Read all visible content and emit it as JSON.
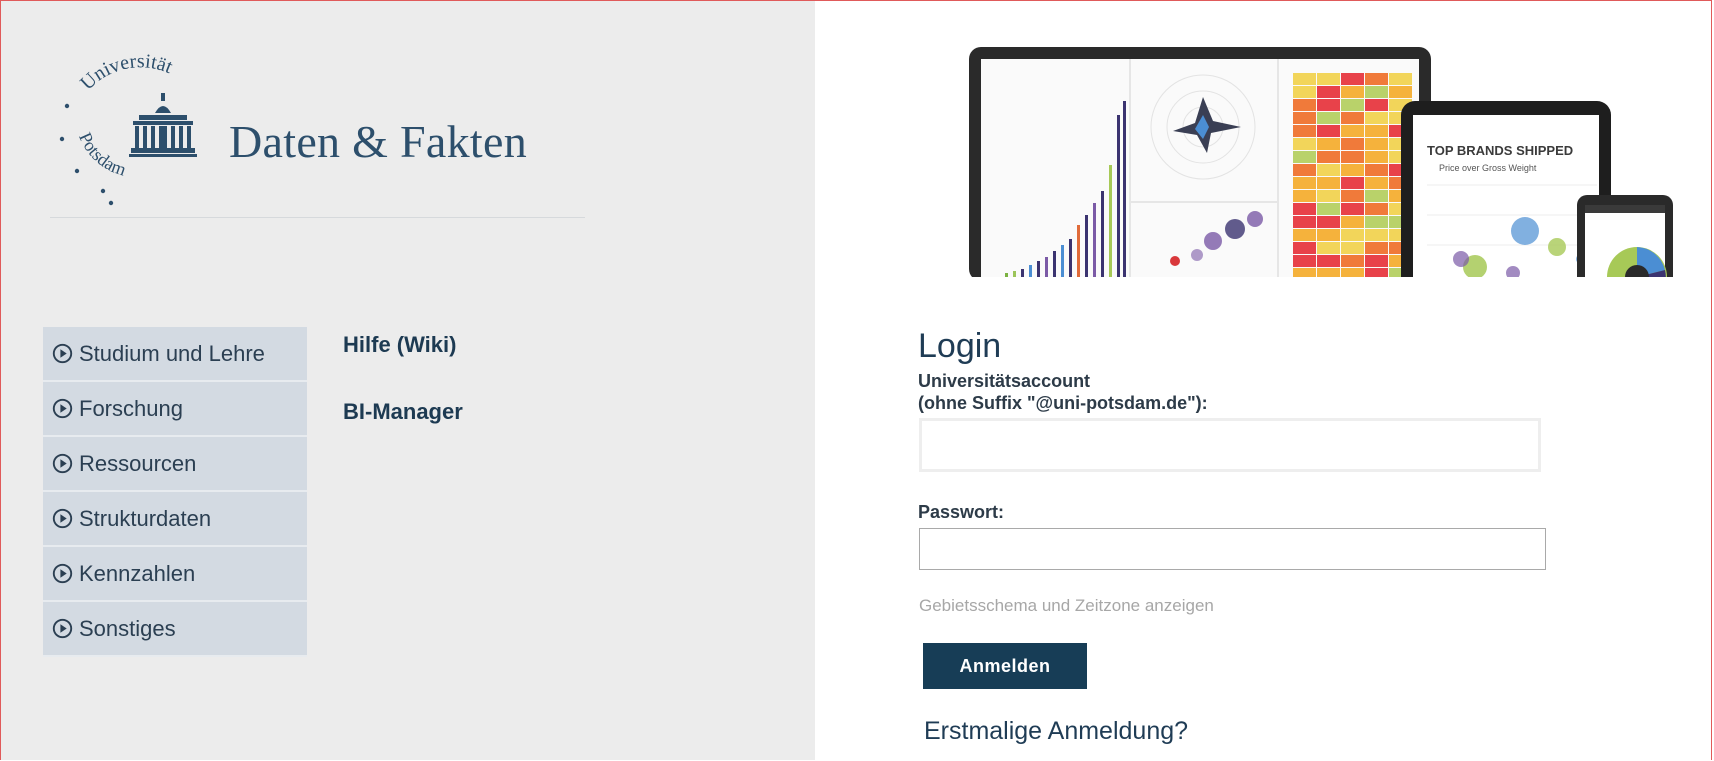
{
  "logo": {
    "arc_text": "Universität",
    "lower_text": "Potsdam",
    "title": "Daten & Fakten"
  },
  "nav": {
    "items": [
      {
        "label": "Studium und Lehre"
      },
      {
        "label": "Forschung"
      },
      {
        "label": "Ressourcen"
      },
      {
        "label": "Strukturdaten"
      },
      {
        "label": "Kennzahlen"
      },
      {
        "label": "Sonstiges"
      }
    ]
  },
  "links": {
    "wiki": "Hilfe (Wiki)",
    "bi_manager": "BI-Manager"
  },
  "showcase": {
    "tablet_title": "TOP BRANDS SHIPPED",
    "tablet_subtitle": "Price over Gross Weight"
  },
  "login": {
    "title": "Login",
    "account_label_line1": "Universitätsaccount",
    "account_label_line2": "(ohne Suffix \"@uni-potsdam.de\"):",
    "account_value": "",
    "password_label": "Passwort:",
    "password_value": "",
    "locale_link": "Gebietsschema und Zeitzone anzeigen",
    "submit_label": "Anmelden",
    "first_login": "Erstmalige Anmeldung?"
  },
  "colors": {
    "left_bg": "#ececec",
    "nav_bg": "#d3dae2",
    "brand": "#2d4f6c",
    "button_bg": "#173d56",
    "frame_border": "#e05a5a"
  }
}
